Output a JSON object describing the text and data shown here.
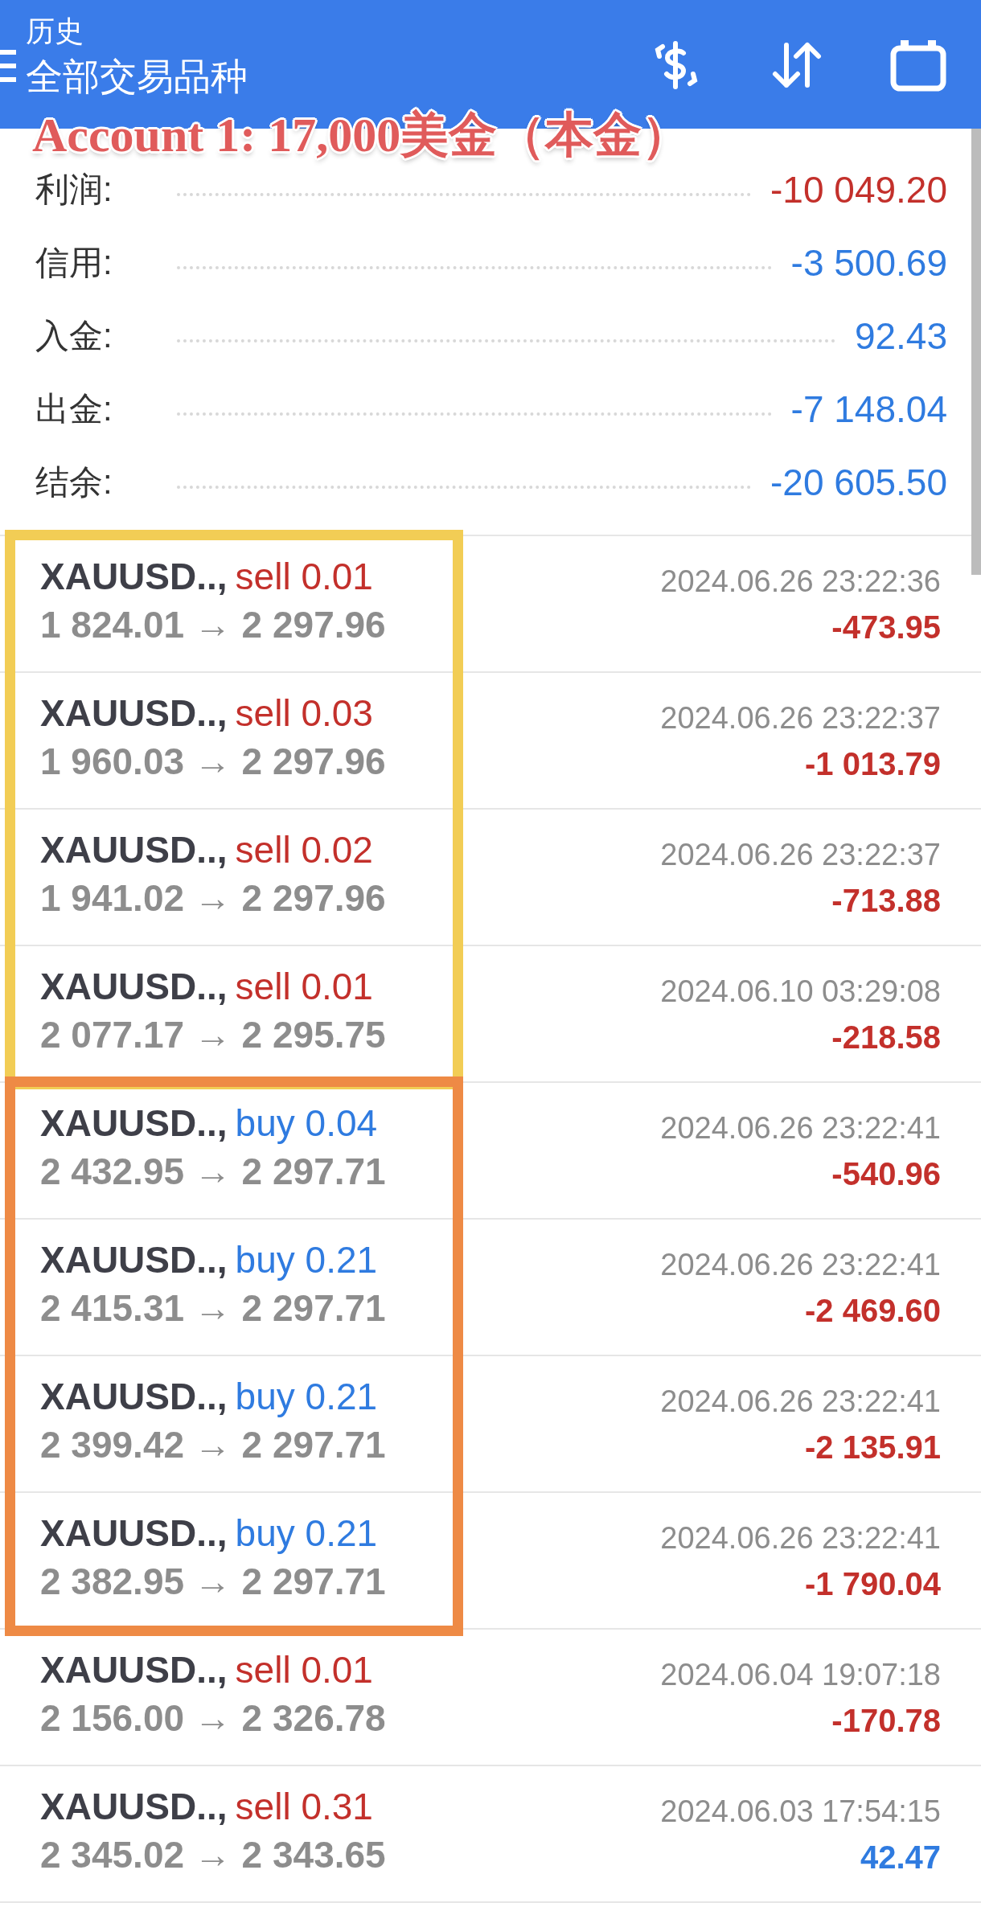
{
  "header": {
    "title": "历史",
    "subtitle": "全部交易品种"
  },
  "annotation": "Account 1: 17,000美金（本金）",
  "summary": [
    {
      "label": "利润:",
      "value": "-10 049.20",
      "color": "#c3302b"
    },
    {
      "label": "信用:",
      "value": "-3 500.69",
      "color": "#2f7be0"
    },
    {
      "label": "入金:",
      "value": "92.43",
      "color": "#2f7be0"
    },
    {
      "label": "出金:",
      "value": "-7 148.04",
      "color": "#2f7be0"
    },
    {
      "label": "结余:",
      "value": "-20 605.50",
      "color": "#2f7be0"
    }
  ],
  "trade_groups": [
    {
      "color": "#f2cd55",
      "trades": [
        {
          "symbol": "XAUUSD..,",
          "side": "sell",
          "lots": "0.01",
          "color": "#c3302b",
          "prices": "1 824.01 → 2 297.96",
          "time": "2024.06.26 23:22:36",
          "profit": "-473.95"
        },
        {
          "symbol": "XAUUSD..,",
          "side": "sell",
          "lots": "0.03",
          "color": "#c3302b",
          "prices": "1 960.03 → 2 297.96",
          "time": "2024.06.26 23:22:37",
          "profit": "-1 013.79"
        },
        {
          "symbol": "XAUUSD..,",
          "side": "sell",
          "lots": "0.02",
          "color": "#c3302b",
          "prices": "1 941.02 → 2 297.96",
          "time": "2024.06.26 23:22:37",
          "profit": "-713.88"
        },
        {
          "symbol": "XAUUSD..,",
          "side": "sell",
          "lots": "0.01",
          "color": "#c3302b",
          "prices": "2 077.17 → 2 295.75",
          "time": "2024.06.10 03:29:08",
          "profit": "-218.58"
        }
      ]
    },
    {
      "color": "#ee8a45",
      "trades": [
        {
          "symbol": "XAUUSD..,",
          "side": "buy",
          "lots": "0.04",
          "color": "#2f7be0",
          "prices": "2 432.95 → 2 297.71",
          "time": "2024.06.26 23:22:41",
          "profit": "-540.96"
        },
        {
          "symbol": "XAUUSD..,",
          "side": "buy",
          "lots": "0.21",
          "color": "#2f7be0",
          "prices": "2 415.31 → 2 297.71",
          "time": "2024.06.26 23:22:41",
          "profit": "-2 469.60"
        },
        {
          "symbol": "XAUUSD..,",
          "side": "buy",
          "lots": "0.21",
          "color": "#2f7be0",
          "prices": "2 399.42 → 2 297.71",
          "time": "2024.06.26 23:22:41",
          "profit": "-2 135.91"
        },
        {
          "symbol": "XAUUSD..,",
          "side": "buy",
          "lots": "0.21",
          "color": "#2f7be0",
          "prices": "2 382.95 → 2 297.71",
          "time": "2024.06.26 23:22:41",
          "profit": "-1 790.04"
        }
      ]
    },
    {
      "trades": [
        {
          "symbol": "XAUUSD..,",
          "side": "sell",
          "lots": "0.01",
          "color": "#c3302b",
          "prices": "2 156.00 → 2 326.78",
          "time": "2024.06.04 19:07:18",
          "profit": "-170.78"
        },
        {
          "symbol": "XAUUSD..,",
          "side": "sell",
          "lots": "0.31",
          "color": "#c3302b",
          "prices": "2 345.02 → 2 343.65",
          "time": "2024.06.03 17:54:15",
          "profit": "42.47"
        }
      ]
    }
  ]
}
